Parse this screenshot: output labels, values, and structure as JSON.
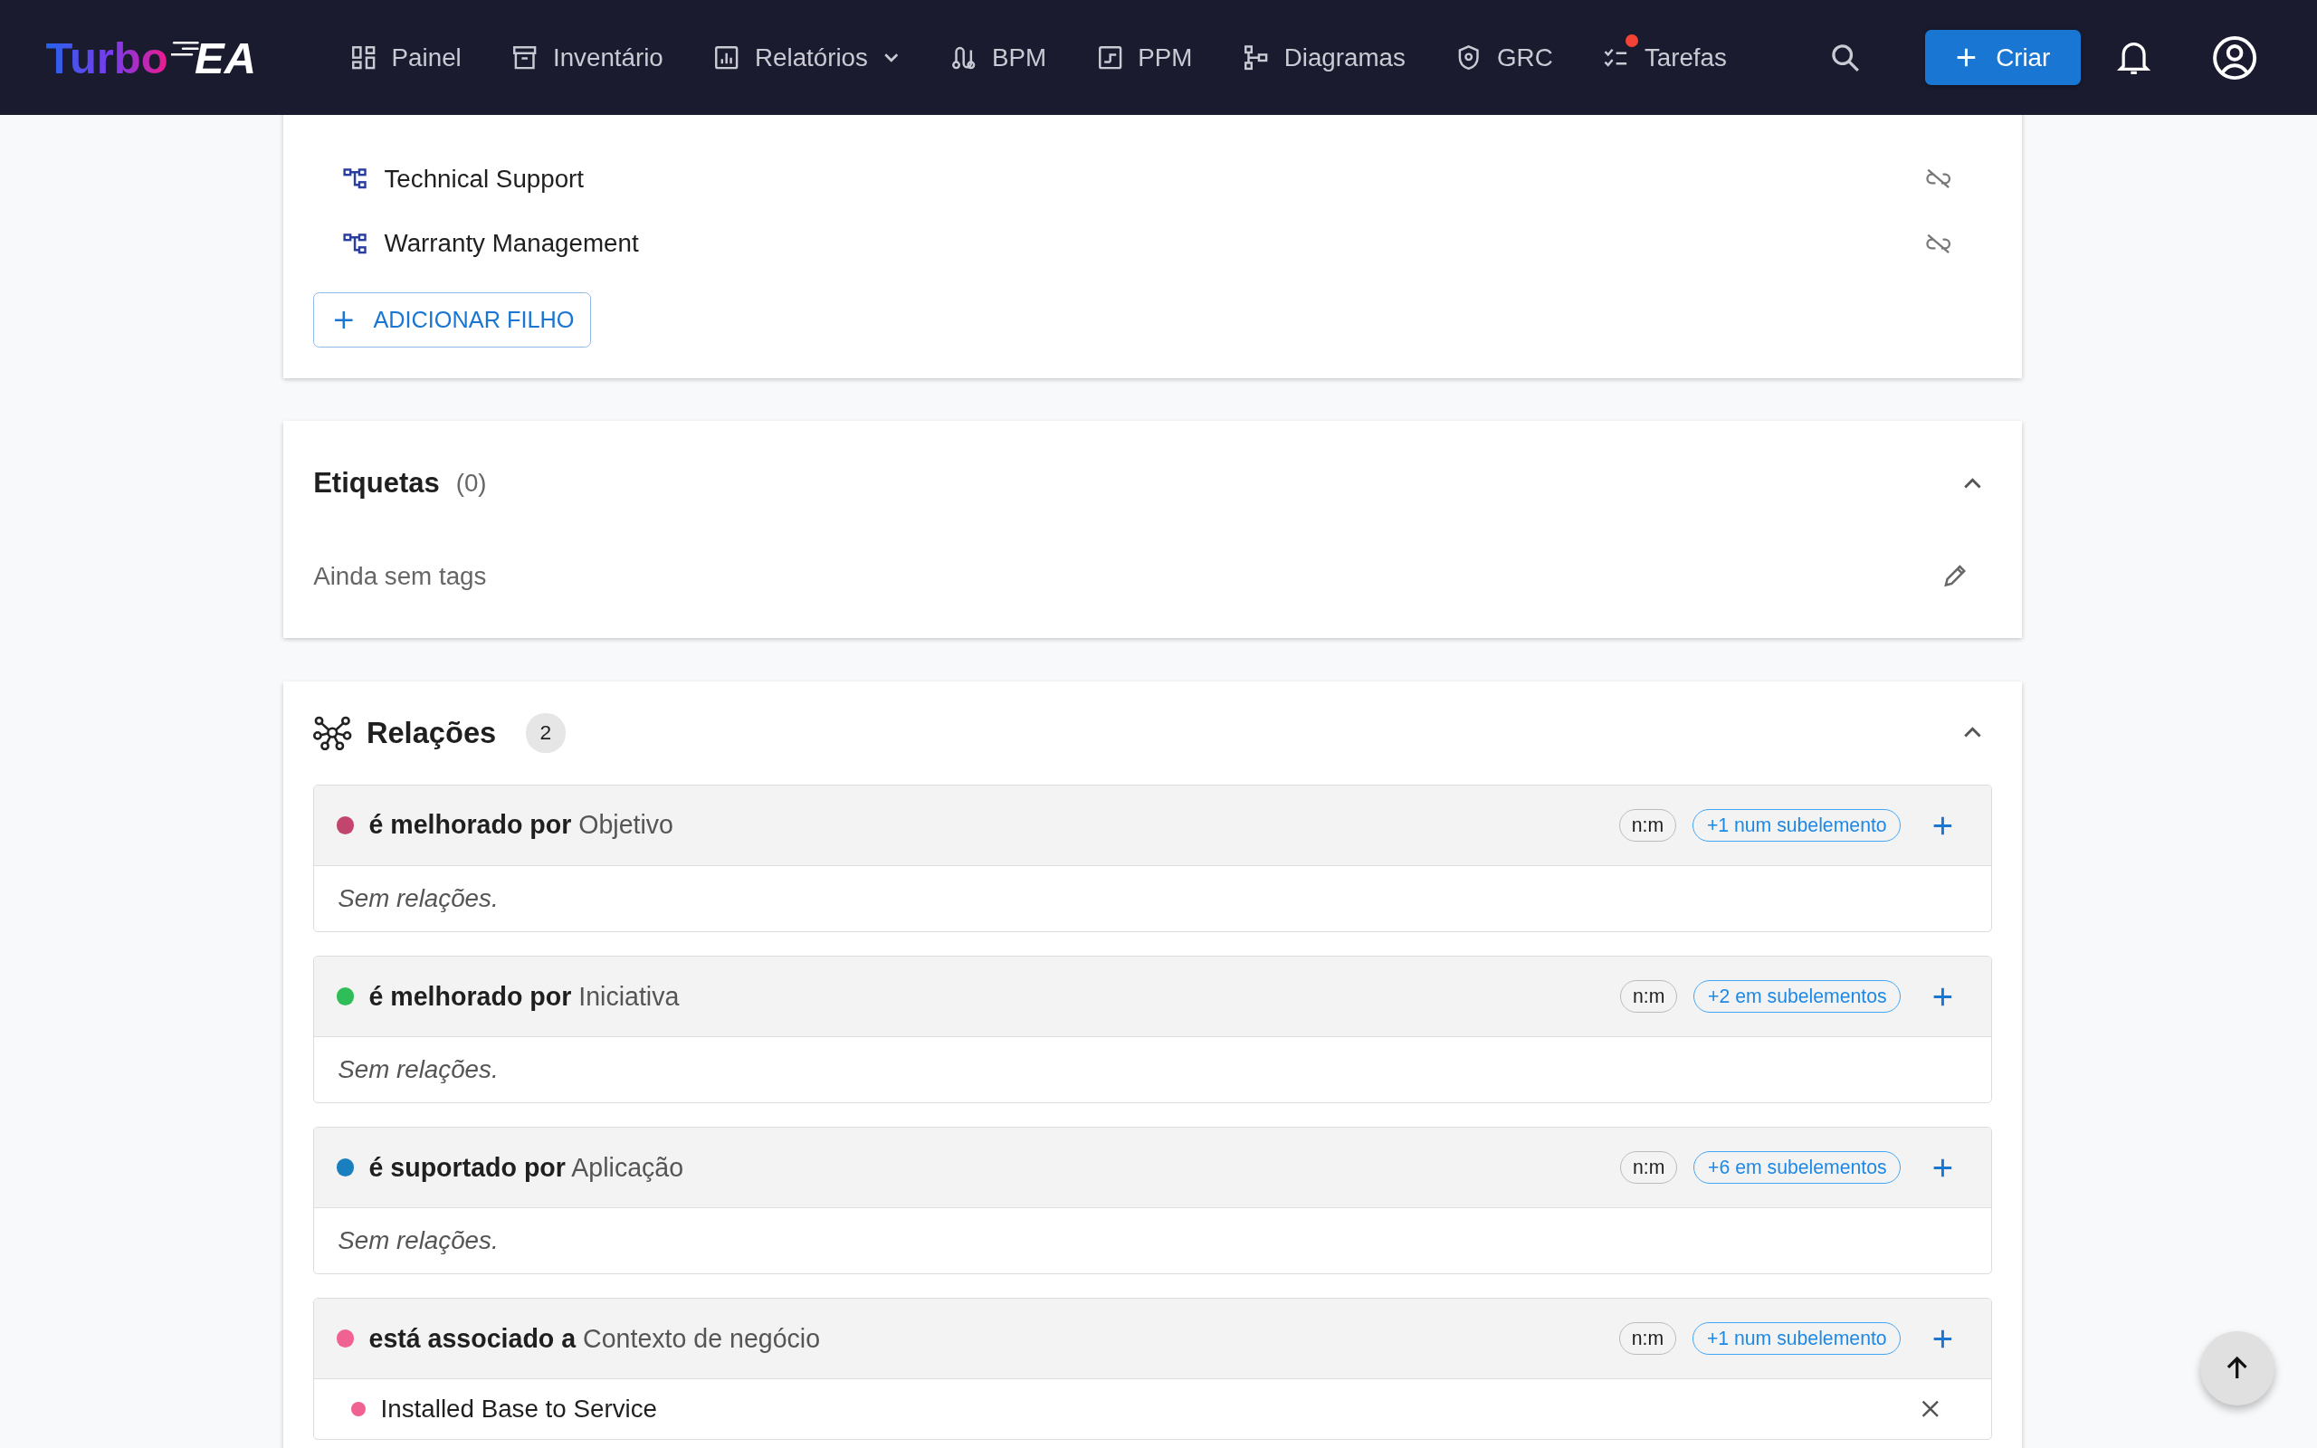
{
  "header": {
    "logo": {
      "primary": "Turbo",
      "accent": "EA"
    },
    "nav": [
      {
        "kind": "dashboard",
        "label": "Painel",
        "has_dropdown": false,
        "notification_dot": false
      },
      {
        "kind": "archive",
        "label": "Inventário",
        "has_dropdown": false,
        "notification_dot": false
      },
      {
        "kind": "report",
        "label": "Relatórios",
        "has_dropdown": true,
        "notification_dot": false
      },
      {
        "kind": "process",
        "label": "BPM",
        "has_dropdown": false,
        "notification_dot": false
      },
      {
        "kind": "project",
        "label": "PPM",
        "has_dropdown": false,
        "notification_dot": false
      },
      {
        "kind": "diagram",
        "label": "Diagramas",
        "has_dropdown": false,
        "notification_dot": false
      },
      {
        "kind": "shield",
        "label": "GRC",
        "has_dropdown": false,
        "notification_dot": false
      },
      {
        "kind": "tasks",
        "label": "Tarefas",
        "has_dropdown": false,
        "notification_dot": true
      }
    ],
    "create_button": "Criar"
  },
  "children_card": {
    "items": [
      "Technical Support",
      "Warranty Management"
    ],
    "add_button": "ADICIONAR FILHO"
  },
  "tags_card": {
    "title": "Etiquetas",
    "count": "(0)",
    "expanded": true,
    "empty_text": "Ainda sem tags"
  },
  "relations_card": {
    "title": "Relações",
    "count": "2",
    "expanded": true,
    "groups": [
      {
        "color": "#c2456e",
        "verb": "é melhorado por",
        "target": "Objetivo",
        "cardinality": "n:m",
        "subelements": "+1 num subelemento",
        "empty_text": "Sem relações."
      },
      {
        "color": "#2ebd59",
        "verb": "é melhorado por",
        "target": "Iniciativa",
        "cardinality": "n:m",
        "subelements": "+2 em subelementos",
        "empty_text": "Sem relações."
      },
      {
        "color": "#1a7fbf",
        "verb": "é suportado por",
        "target": "Aplicação",
        "cardinality": "n:m",
        "subelements": "+6 em subelementos",
        "empty_text": "Sem relações."
      },
      {
        "color": "#f06292",
        "verb": "está associado a",
        "target": "Contexto de negócio",
        "cardinality": "n:m",
        "subelements": "+1 num subelemento",
        "items": [
          {
            "name": "Installed Base to Service",
            "color": "#f06292"
          }
        ]
      }
    ]
  }
}
